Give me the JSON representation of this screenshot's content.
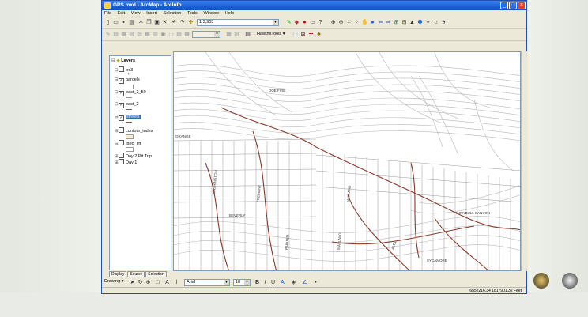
{
  "window": {
    "title": "GPS.mxd - ArcMap - ArcInfo",
    "minimize": "_",
    "maximize": "□",
    "close": "×"
  },
  "menu": [
    "File",
    "Edit",
    "View",
    "Insert",
    "Selection",
    "Tools",
    "Window",
    "Help"
  ],
  "toolbar1": {
    "scale": "1:3,903"
  },
  "toolbar2": {
    "hawths_tools": "HawthsTools ▾"
  },
  "toc": {
    "root": "Layers",
    "layers": [
      {
        "name": "trc3",
        "checked": false
      },
      {
        "name": "parcels",
        "checked": true
      },
      {
        "name": "east_2_50",
        "checked": true
      },
      {
        "name": "east_2",
        "checked": true
      },
      {
        "name": "streets",
        "checked": true,
        "selected": true
      },
      {
        "name": "contour_index",
        "checked": false
      },
      {
        "name": "tdeo_lift",
        "checked": false
      },
      {
        "name": "Day 2 Pit Trip",
        "checked": false
      },
      {
        "name": "Day 1",
        "checked": false
      }
    ],
    "tabs": [
      "Display",
      "Source",
      "Selection"
    ]
  },
  "map": {
    "labels": [
      "DOE FIRE",
      "ORANGE",
      "WASHINGTON",
      "BEVERLY",
      "FREMONT",
      "PAINTER",
      "MAYLAND",
      "MAYLAND",
      "ALTA",
      "SYCAMORE",
      "TURNBULL CANYON"
    ]
  },
  "drawing": {
    "label": "Drawing ▾",
    "font": "Arial",
    "size": "10"
  },
  "status": {
    "coords": "6552216.34  1817901.32 Feet"
  }
}
